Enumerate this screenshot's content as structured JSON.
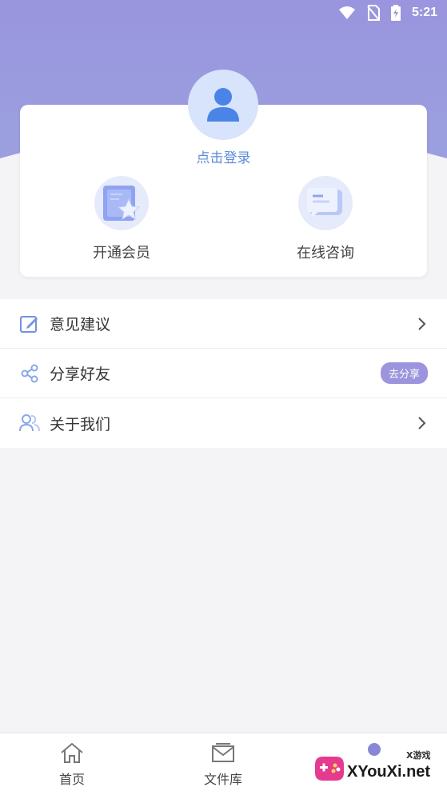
{
  "status_bar": {
    "time": "5:21",
    "icons": [
      "wifi-icon",
      "no-sim-icon",
      "battery-charging-icon"
    ]
  },
  "profile": {
    "login_label": "点击登录",
    "avatar_icon": "user-icon"
  },
  "features": [
    {
      "label": "开通会员",
      "icon": "vip-star-icon"
    },
    {
      "label": "在线咨询",
      "icon": "chat-bubble-icon"
    }
  ],
  "menu": [
    {
      "label": "意见建议",
      "icon": "edit-icon",
      "trailing": "chevron-right-icon"
    },
    {
      "label": "分享好友",
      "icon": "share-icon",
      "badge": "去分享"
    },
    {
      "label": "关于我们",
      "icon": "users-icon",
      "trailing": "chevron-right-icon"
    }
  ],
  "bottom_nav": [
    {
      "label": "首页",
      "icon": "home-icon"
    },
    {
      "label": "文件库",
      "icon": "mail-icon"
    },
    {
      "label": "",
      "icon": "profile-icon"
    }
  ],
  "watermark": {
    "brand": "XYouXi.net",
    "tag": "X游戏"
  },
  "colors": {
    "header": "#9a95de",
    "accent": "#5b8bd8",
    "badge": "#9c95dd",
    "background": "#f4f4f6"
  }
}
